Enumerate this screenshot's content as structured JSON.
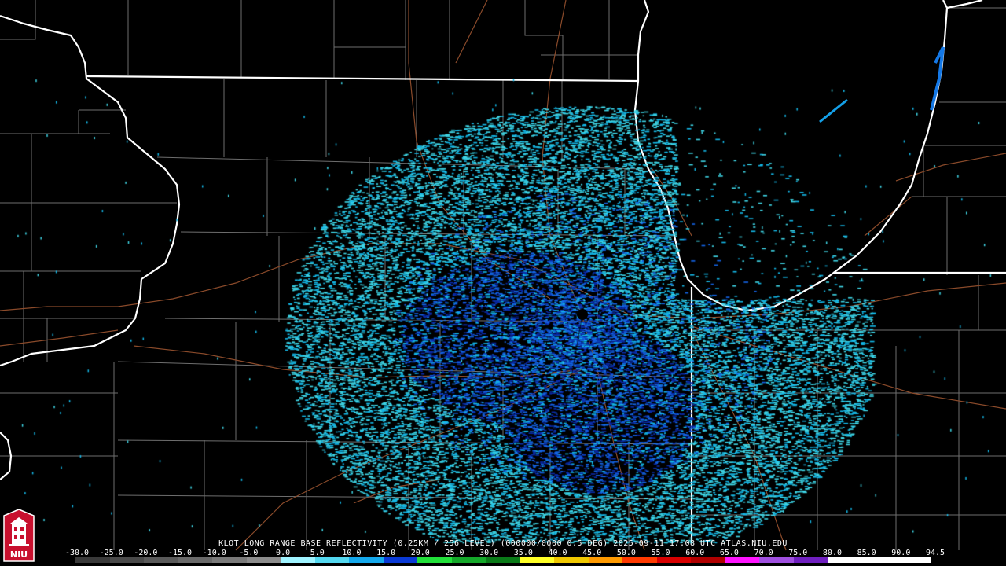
{
  "product": {
    "caption": "KLOT LONG RANGE BASE REFLECTIVITY (0.25KM / 256 LEVEL) (000000/0000 0.5 DEG) 2025-09-11 17:08 UTC  ATLAS.NIU.EDU"
  },
  "logo": {
    "text": "NIU",
    "icon": "university-seal-icon"
  },
  "legend": {
    "labels": [
      "-30.0",
      "-25.0",
      "-20.0",
      "-15.0",
      "-10.0",
      "-5.0",
      "0.0",
      "5.0",
      "10.0",
      "15.0",
      "20.0",
      "25.0",
      "30.0",
      "35.0",
      "40.0",
      "45.0",
      "50.0",
      "55.0",
      "60.0",
      "65.0",
      "70.0",
      "75.0",
      "80.0",
      "85.0",
      "90.0",
      "94.5"
    ],
    "colors": [
      "#3a3a3a",
      "#4a4a4a",
      "#5a5a5a",
      "#6a6a6a",
      "#7a7a7a",
      "#8c8c8c",
      "#9ff3ff",
      "#54d8f0",
      "#14a8ec",
      "#0a3ad6",
      "#22e03a",
      "#15a82a",
      "#0a7a18",
      "#ffff26",
      "#f0c800",
      "#ff9a00",
      "#ff3a00",
      "#d80000",
      "#b00000",
      "#ff14ff",
      "#a050e0",
      "#7020c0",
      "#ffffff",
      "#ffffff",
      "#ffffff"
    ]
  },
  "radar": {
    "site": "KLOT",
    "colors": {
      "light_cyan": "#3fd6e6",
      "cyan": "#14b8e8",
      "blue": "#1464e6",
      "deep_blue": "#0a2aa8",
      "site_marker": "#000000"
    }
  },
  "map": {
    "colors": {
      "state_border": "#ffffff",
      "county_border": "#7a7a7a",
      "highway": "#8a4a2a",
      "background": "#000000"
    }
  }
}
